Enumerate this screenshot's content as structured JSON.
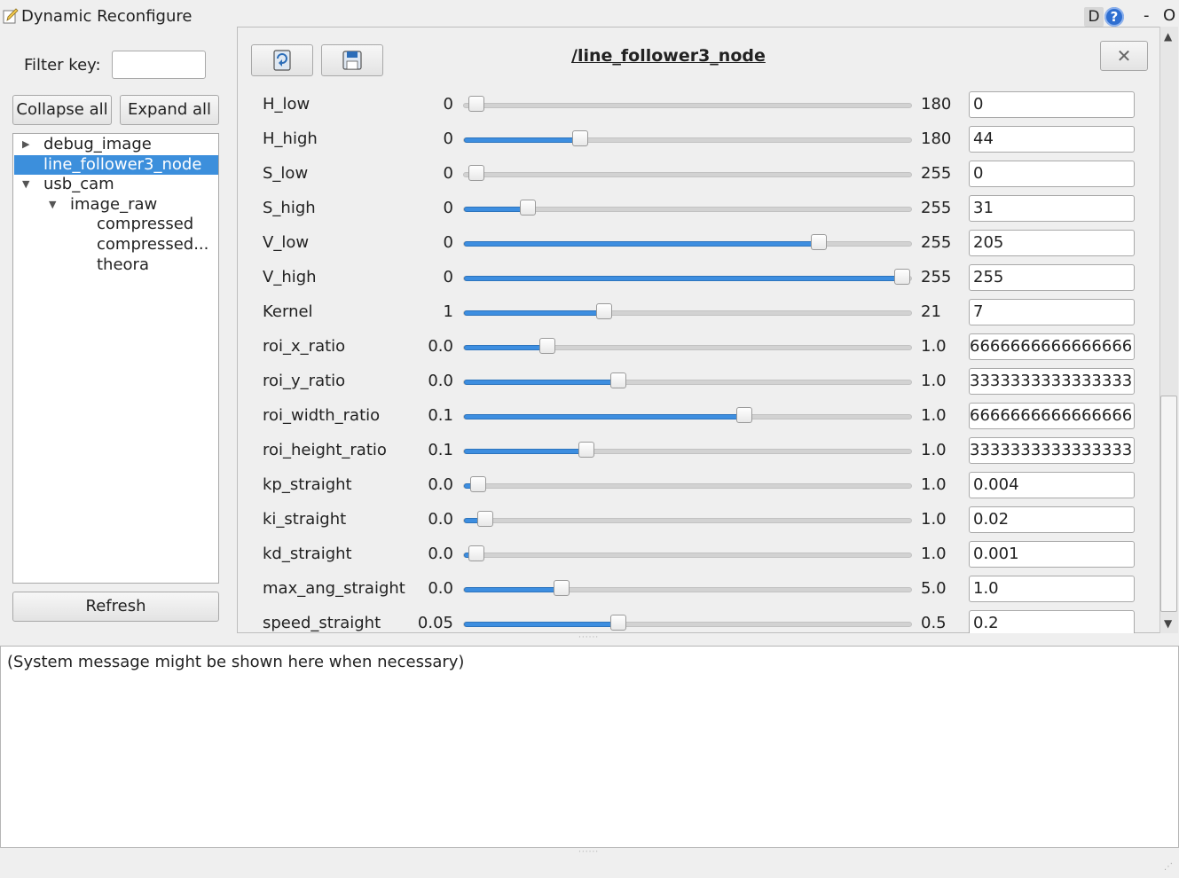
{
  "window": {
    "title": "Dynamic Reconfigure",
    "icon": "edit-document-icon",
    "dock_label": "D",
    "help_label": "?",
    "minimize_label": "-",
    "close_label": "O"
  },
  "left_panel": {
    "filter_label": "Filter key:",
    "filter_value": "",
    "collapse_all_label": "Collapse all",
    "expand_all_label": "Expand all",
    "tree": [
      {
        "label": "debug_image",
        "depth": 0,
        "arrow": "right",
        "selected": false
      },
      {
        "label": "line_follower3_node",
        "depth": 0,
        "arrow": "none",
        "selected": true
      },
      {
        "label": "usb_cam",
        "depth": 0,
        "arrow": "down",
        "selected": false
      },
      {
        "label": "image_raw",
        "depth": 1,
        "arrow": "down",
        "selected": false
      },
      {
        "label": "compressed",
        "depth": 2,
        "arrow": "none",
        "selected": false
      },
      {
        "label": "compressed...",
        "depth": 2,
        "arrow": "none",
        "selected": false
      },
      {
        "label": "theora",
        "depth": 2,
        "arrow": "none",
        "selected": false
      }
    ],
    "refresh_label": "Refresh"
  },
  "node_panel": {
    "title": "/line_follower3_node",
    "close_icon": "close-icon",
    "reload_icon": "reload-icon",
    "save_icon": "save-icon",
    "params": [
      {
        "name": "H_low",
        "min": "0",
        "max": "180",
        "value": "0",
        "fraction": 0.0
      },
      {
        "name": "H_high",
        "min": "0",
        "max": "180",
        "value": "44",
        "fraction": 0.2444
      },
      {
        "name": "S_low",
        "min": "0",
        "max": "255",
        "value": "0",
        "fraction": 0.0
      },
      {
        "name": "S_high",
        "min": "0",
        "max": "255",
        "value": "31",
        "fraction": 0.1216
      },
      {
        "name": "V_low",
        "min": "0",
        "max": "255",
        "value": "205",
        "fraction": 0.8039
      },
      {
        "name": "V_high",
        "min": "0",
        "max": "255",
        "value": "255",
        "fraction": 1.0
      },
      {
        "name": "Kernel",
        "min": "1",
        "max": "21",
        "value": "7",
        "fraction": 0.3
      },
      {
        "name": "roi_x_ratio",
        "min": "0.0",
        "max": "1.0",
        "value": "6666666666666666",
        "fraction": 0.1667
      },
      {
        "name": "roi_y_ratio",
        "min": "0.0",
        "max": "1.0",
        "value": "3333333333333333",
        "fraction": 0.3333
      },
      {
        "name": "roi_width_ratio",
        "min": "0.1",
        "max": "1.0",
        "value": "6666666666666666",
        "fraction": 0.6296
      },
      {
        "name": "roi_height_ratio",
        "min": "0.1",
        "max": "1.0",
        "value": "3333333333333333",
        "fraction": 0.2593
      },
      {
        "name": "kp_straight",
        "min": "0.0",
        "max": "1.0",
        "value": "0.004",
        "fraction": 0.004
      },
      {
        "name": "ki_straight",
        "min": "0.0",
        "max": "1.0",
        "value": "0.02",
        "fraction": 0.02
      },
      {
        "name": "kd_straight",
        "min": "0.0",
        "max": "1.0",
        "value": "0.001",
        "fraction": 0.001
      },
      {
        "name": "max_ang_straight",
        "min": "0.0",
        "max": "5.0",
        "value": "1.0",
        "fraction": 0.2
      },
      {
        "name": "speed_straight",
        "min": "0.05",
        "max": "0.5",
        "value": "0.2",
        "fraction": 0.3333
      }
    ]
  },
  "message_area": {
    "text": "(System message might be shown here when necessary)"
  },
  "colors": {
    "accent": "#3c8fdc",
    "slider_fill": "#3d8ee0"
  }
}
